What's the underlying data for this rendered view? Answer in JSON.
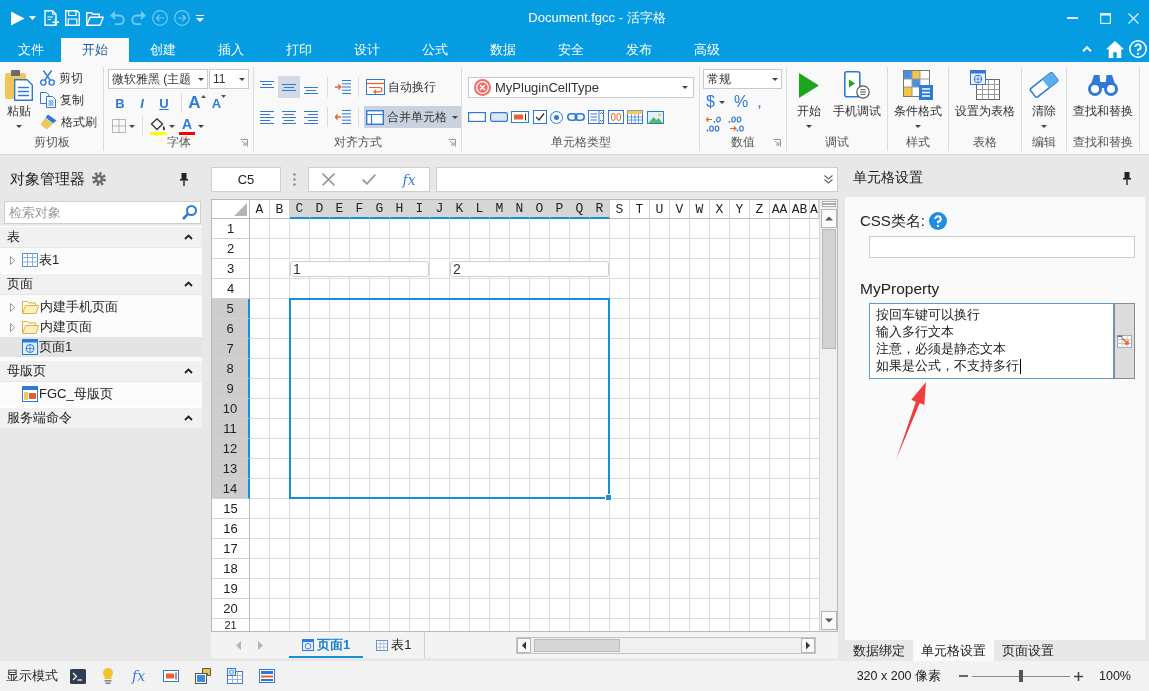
{
  "window": {
    "title": "Document.fgcc - 活字格"
  },
  "quick_access": [
    {
      "kind": "run",
      "disabled": false
    },
    {
      "kind": "new",
      "disabled": false
    },
    {
      "kind": "save",
      "disabled": false
    },
    {
      "kind": "open",
      "disabled": false
    },
    {
      "kind": "undo",
      "disabled": true
    },
    {
      "kind": "redo",
      "disabled": true
    },
    {
      "kind": "back",
      "disabled": true
    },
    {
      "kind": "forward",
      "disabled": true
    }
  ],
  "ribbon_tabs": [
    {
      "label": "文件",
      "selected": false
    },
    {
      "label": "开始",
      "selected": true
    },
    {
      "label": "创建",
      "selected": false
    },
    {
      "label": "插入",
      "selected": false
    },
    {
      "label": "打印",
      "selected": false
    },
    {
      "label": "设计",
      "selected": false
    },
    {
      "label": "公式",
      "selected": false
    },
    {
      "label": "数据",
      "selected": false
    },
    {
      "label": "安全",
      "selected": false
    },
    {
      "label": "发布",
      "selected": false
    },
    {
      "label": "高级",
      "selected": false
    }
  ],
  "ribbon_groups": [
    {
      "kind": "clipboard",
      "label": "剪切板",
      "buttons": [
        {
          "kind": "paste",
          "label": "粘贴",
          "dropdown": true
        },
        {
          "kind": "cut",
          "label": "剪切",
          "dropdown": false
        },
        {
          "kind": "copy",
          "label": "复制",
          "dropdown": false
        },
        {
          "kind": "format_painter",
          "label": "格式刷",
          "dropdown": false
        }
      ]
    },
    {
      "kind": "font",
      "label": "字体",
      "family": "微软雅黑 (主题",
      "size": "11",
      "styles": [
        {
          "kind": "bold",
          "glyph": "B"
        },
        {
          "kind": "italic",
          "glyph": "I"
        },
        {
          "kind": "underline",
          "glyph": "U"
        },
        {
          "kind": "grow",
          "glyph": "A"
        },
        {
          "kind": "shrink",
          "glyph": "A"
        }
      ],
      "fill": {
        "color": "#ffff00"
      },
      "font_color": {
        "glyph": "A",
        "color": "#ff0000"
      }
    },
    {
      "kind": "alignment",
      "label": "对齐方式",
      "vertical": [
        {
          "selected": false
        },
        {
          "selected": true
        },
        {
          "selected": false
        }
      ],
      "horizontal": [
        {
          "selected": false
        },
        {
          "selected": false
        },
        {
          "selected": false
        }
      ],
      "wrap_text": {
        "label": "自动换行",
        "selected": false
      },
      "merge": {
        "label": "合并单元格",
        "selected": true
      }
    },
    {
      "kind": "cell_type",
      "label": "单元格类型",
      "value": "MyPluginCellType"
    },
    {
      "kind": "number",
      "label": "数值",
      "format": "常规",
      "symbols": [
        "$",
        "%",
        ","
      ]
    },
    {
      "kind": "large_buttons",
      "label": "调试",
      "buttons": [
        {
          "kind": "run",
          "label": "开始",
          "dropdown": true
        },
        {
          "kind": "mobile",
          "label": "手机调试",
          "dropdown": false
        }
      ]
    },
    {
      "kind": "large_buttons",
      "label": "样式",
      "buttons": [
        {
          "kind": "conditional",
          "label": "条件格式",
          "dropdown": true
        }
      ]
    },
    {
      "kind": "large_buttons",
      "label": "表格",
      "buttons": [
        {
          "kind": "table",
          "label": "设置为表格",
          "dropdown": false
        }
      ]
    },
    {
      "kind": "large_buttons",
      "label": "编辑",
      "buttons": [
        {
          "kind": "eraser",
          "label": "清除",
          "dropdown": true
        }
      ]
    },
    {
      "kind": "large_buttons",
      "label": "查找和替换",
      "buttons": [
        {
          "kind": "binoculars",
          "label": "查找和替换",
          "dropdown": false
        }
      ]
    }
  ],
  "object_manager": {
    "title": "对象管理器",
    "search": {
      "placeholder": "检索对象"
    },
    "sections": [
      {
        "title": "表",
        "expanded": true,
        "items": [
          {
            "kind": "table",
            "label": "表1",
            "expandable": true,
            "selected": false
          }
        ]
      },
      {
        "title": "页面",
        "expanded": true,
        "items": [
          {
            "kind": "folder",
            "label": "内建手机页面",
            "expandable": true,
            "selected": false
          },
          {
            "kind": "folder",
            "label": "内建页面",
            "expandable": true,
            "selected": false
          },
          {
            "kind": "page",
            "label": "页面1",
            "expandable": false,
            "selected": true
          }
        ]
      },
      {
        "title": "母版页",
        "expanded": true,
        "items": [
          {
            "kind": "master",
            "label": "FGC_母版页",
            "expandable": false,
            "selected": false
          }
        ]
      },
      {
        "title": "服务端命令",
        "expanded": true
      }
    ]
  },
  "formula_bar": {
    "cell_ref": "C5",
    "function_glyph": "fx"
  },
  "sheet": {
    "columns": [
      {
        "label": "A",
        "selected": false
      },
      {
        "label": "B",
        "selected": false
      },
      {
        "label": "C",
        "selected": true
      },
      {
        "label": "D",
        "selected": true
      },
      {
        "label": "E",
        "selected": true
      },
      {
        "label": "F",
        "selected": true
      },
      {
        "label": "G",
        "selected": true
      },
      {
        "label": "H",
        "selected": true
      },
      {
        "label": "I",
        "selected": true
      },
      {
        "label": "J",
        "selected": true
      },
      {
        "label": "K",
        "selected": true
      },
      {
        "label": "L",
        "selected": true
      },
      {
        "label": "M",
        "selected": true
      },
      {
        "label": "N",
        "selected": true
      },
      {
        "label": "O",
        "selected": true
      },
      {
        "label": "P",
        "selected": true
      },
      {
        "label": "Q",
        "selected": true
      },
      {
        "label": "R",
        "selected": true
      },
      {
        "label": "S",
        "selected": false
      },
      {
        "label": "T",
        "selected": false
      },
      {
        "label": "U",
        "selected": false
      },
      {
        "label": "V",
        "selected": false
      },
      {
        "label": "W",
        "selected": false
      },
      {
        "label": "X",
        "selected": false
      },
      {
        "label": "Y",
        "selected": false
      },
      {
        "label": "Z",
        "selected": false
      },
      {
        "label": "AA",
        "selected": false
      },
      {
        "label": "AB",
        "selected": false
      },
      {
        "label": "A",
        "selected": false
      }
    ],
    "rows": [
      {
        "label": "1",
        "selected": false
      },
      {
        "label": "2",
        "selected": false
      },
      {
        "label": "3",
        "selected": false
      },
      {
        "label": "4",
        "selected": false
      },
      {
        "label": "5",
        "selected": true
      },
      {
        "label": "6",
        "selected": true
      },
      {
        "label": "7",
        "selected": true
      },
      {
        "label": "8",
        "selected": true
      },
      {
        "label": "9",
        "selected": true
      },
      {
        "label": "10",
        "selected": true
      },
      {
        "label": "11",
        "selected": true
      },
      {
        "label": "12",
        "selected": true
      },
      {
        "label": "13",
        "selected": true
      },
      {
        "label": "14",
        "selected": true
      },
      {
        "label": "15",
        "selected": false
      },
      {
        "label": "16",
        "selected": false
      },
      {
        "label": "17",
        "selected": false
      },
      {
        "label": "18",
        "selected": false
      },
      {
        "label": "19",
        "selected": false
      },
      {
        "label": "20",
        "selected": false
      },
      {
        "label": "21",
        "selected": false
      }
    ],
    "cells": [
      {
        "value": "1"
      },
      {
        "value": "2"
      }
    ],
    "tabs": [
      {
        "kind": "page",
        "label": "页面1",
        "selected": true
      },
      {
        "kind": "table",
        "label": "表1",
        "selected": false
      }
    ]
  },
  "cell_settings": {
    "title": "单元格设置",
    "css_class": {
      "label": "CSS类名:"
    },
    "property": {
      "label": "MyProperty",
      "lines": [
        "按回车键可以换行",
        "输入多行文本",
        "注意，必须是静态文本",
        "如果是公式，不支持多行"
      ]
    },
    "tabs": [
      {
        "label": "数据绑定",
        "selected": false
      },
      {
        "label": "单元格设置",
        "selected": true
      },
      {
        "label": "页面设置",
        "selected": false
      }
    ]
  },
  "status_bar": {
    "mode_label": "显示模式",
    "formula_glyph": "fx",
    "canvas_size": "320 x 200 像素",
    "zoom": {
      "level": 0.5,
      "reading": "100%"
    }
  }
}
